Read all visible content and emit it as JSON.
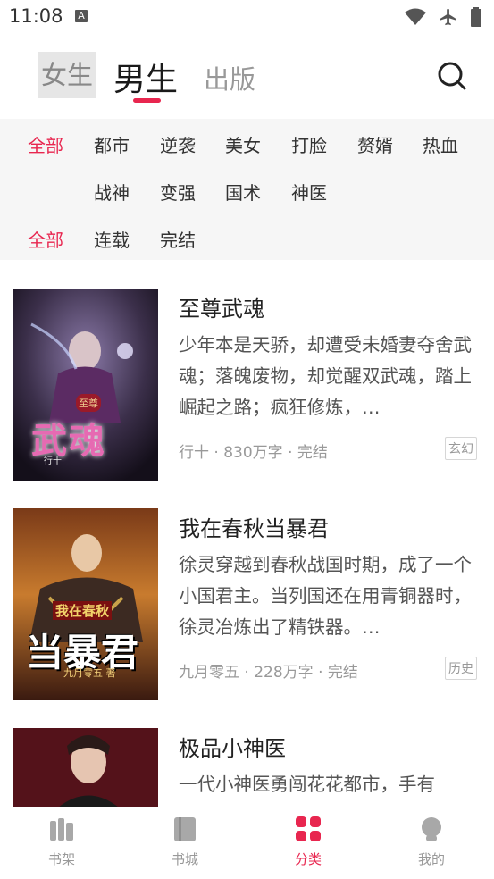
{
  "status": {
    "time": "11:08",
    "notif_badge": "A"
  },
  "topnav": {
    "tabs": [
      {
        "label": "女生"
      },
      {
        "label": "男生"
      },
      {
        "label": "出版"
      }
    ],
    "active_tab": "男生"
  },
  "filters": {
    "category_row1": [
      "全部",
      "都市",
      "逆袭",
      "美女",
      "打脸",
      "赘婿",
      "热血"
    ],
    "category_row2": [
      "战神",
      "变强",
      "国术",
      "神医"
    ],
    "status_row": [
      "全部",
      "连载",
      "完结"
    ]
  },
  "books": [
    {
      "title": "至尊武魂",
      "desc": "少年本是天骄，却遭受未婚妻夺舍武魂；落魄废物，却觉醒双武魂，踏上崛起之路；疯狂修炼，…",
      "meta": "行十 · 830万字 · 完结",
      "tag": "玄幻",
      "cover_text": "武魂",
      "cover_badge": "至尊",
      "cover_author": "行十"
    },
    {
      "title": "我在春秋当暴君",
      "desc": "徐灵穿越到春秋战国时期，成了一个小国君主。当列国还在用青铜器时，徐灵冶炼出了精铁器。…",
      "meta": "九月零五 · 228万字 · 完结",
      "tag": "历史",
      "cover_text": "当暴君",
      "cover_badge": "我在春秋",
      "cover_author": "九月零五 著"
    },
    {
      "title": "极品小神医",
      "desc": "一代小神医勇闯花花都市，手有",
      "meta": "",
      "tag": ""
    }
  ],
  "bottom_nav": [
    {
      "label": "书架"
    },
    {
      "label": "书城"
    },
    {
      "label": "分类"
    },
    {
      "label": "我的"
    }
  ],
  "colors": {
    "accent": "#e8264f",
    "filter_bg": "#f6f6f6"
  }
}
